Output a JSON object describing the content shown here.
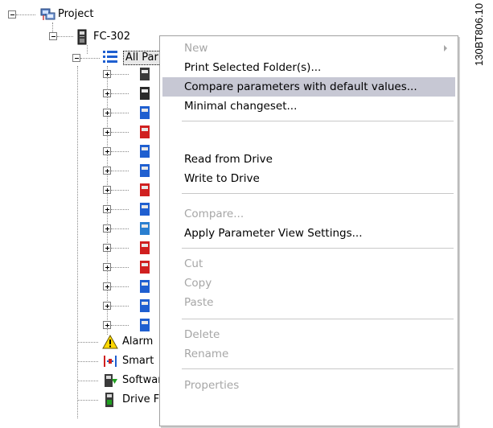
{
  "tree": {
    "root": "Project",
    "drive": "FC-302",
    "all_parameters": "All Par",
    "bottom_items": [
      "Alarm",
      "Smart",
      "Software Upgrader",
      "Drive File System"
    ]
  },
  "context_menu": {
    "items": [
      {
        "label": "New",
        "enabled": false,
        "has_submenu": true
      },
      {
        "label": "Print Selected Folder(s)...",
        "enabled": true
      },
      {
        "label": "Compare parameters with default values...",
        "enabled": true,
        "highlighted": true
      },
      {
        "label": "Minimal changeset...",
        "enabled": true
      },
      {
        "label": "Read from Drive",
        "enabled": true
      },
      {
        "label": "Write to Drive",
        "enabled": true
      },
      {
        "label": "Compare...",
        "enabled": false
      },
      {
        "label": "Apply Parameter View Settings...",
        "enabled": true
      },
      {
        "label": "Cut",
        "enabled": false
      },
      {
        "label": "Copy",
        "enabled": false
      },
      {
        "label": "Paste",
        "enabled": false
      },
      {
        "label": "Delete",
        "enabled": false
      },
      {
        "label": "Rename",
        "enabled": false
      },
      {
        "label": "Properties",
        "enabled": false
      }
    ]
  },
  "doc_code": "130BT806.10",
  "colors": {
    "menu_highlight": "#c7c8d4",
    "disabled_text": "#a6a6a6"
  }
}
